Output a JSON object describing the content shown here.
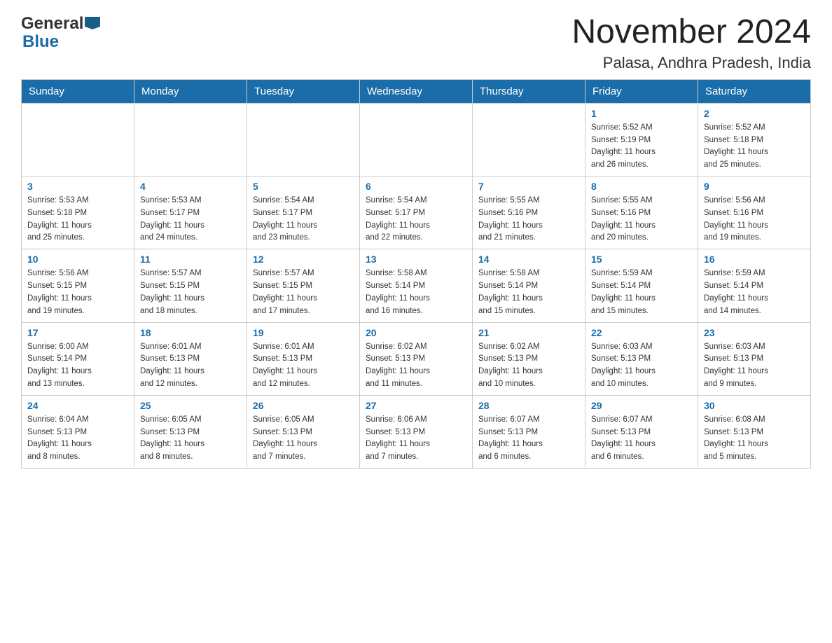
{
  "logo": {
    "general": "General",
    "blue": "Blue"
  },
  "title": "November 2024",
  "subtitle": "Palasa, Andhra Pradesh, India",
  "weekdays": [
    "Sunday",
    "Monday",
    "Tuesday",
    "Wednesday",
    "Thursday",
    "Friday",
    "Saturday"
  ],
  "weeks": [
    [
      {
        "day": "",
        "info": ""
      },
      {
        "day": "",
        "info": ""
      },
      {
        "day": "",
        "info": ""
      },
      {
        "day": "",
        "info": ""
      },
      {
        "day": "",
        "info": ""
      },
      {
        "day": "1",
        "info": "Sunrise: 5:52 AM\nSunset: 5:19 PM\nDaylight: 11 hours\nand 26 minutes."
      },
      {
        "day": "2",
        "info": "Sunrise: 5:52 AM\nSunset: 5:18 PM\nDaylight: 11 hours\nand 25 minutes."
      }
    ],
    [
      {
        "day": "3",
        "info": "Sunrise: 5:53 AM\nSunset: 5:18 PM\nDaylight: 11 hours\nand 25 minutes."
      },
      {
        "day": "4",
        "info": "Sunrise: 5:53 AM\nSunset: 5:17 PM\nDaylight: 11 hours\nand 24 minutes."
      },
      {
        "day": "5",
        "info": "Sunrise: 5:54 AM\nSunset: 5:17 PM\nDaylight: 11 hours\nand 23 minutes."
      },
      {
        "day": "6",
        "info": "Sunrise: 5:54 AM\nSunset: 5:17 PM\nDaylight: 11 hours\nand 22 minutes."
      },
      {
        "day": "7",
        "info": "Sunrise: 5:55 AM\nSunset: 5:16 PM\nDaylight: 11 hours\nand 21 minutes."
      },
      {
        "day": "8",
        "info": "Sunrise: 5:55 AM\nSunset: 5:16 PM\nDaylight: 11 hours\nand 20 minutes."
      },
      {
        "day": "9",
        "info": "Sunrise: 5:56 AM\nSunset: 5:16 PM\nDaylight: 11 hours\nand 19 minutes."
      }
    ],
    [
      {
        "day": "10",
        "info": "Sunrise: 5:56 AM\nSunset: 5:15 PM\nDaylight: 11 hours\nand 19 minutes."
      },
      {
        "day": "11",
        "info": "Sunrise: 5:57 AM\nSunset: 5:15 PM\nDaylight: 11 hours\nand 18 minutes."
      },
      {
        "day": "12",
        "info": "Sunrise: 5:57 AM\nSunset: 5:15 PM\nDaylight: 11 hours\nand 17 minutes."
      },
      {
        "day": "13",
        "info": "Sunrise: 5:58 AM\nSunset: 5:14 PM\nDaylight: 11 hours\nand 16 minutes."
      },
      {
        "day": "14",
        "info": "Sunrise: 5:58 AM\nSunset: 5:14 PM\nDaylight: 11 hours\nand 15 minutes."
      },
      {
        "day": "15",
        "info": "Sunrise: 5:59 AM\nSunset: 5:14 PM\nDaylight: 11 hours\nand 15 minutes."
      },
      {
        "day": "16",
        "info": "Sunrise: 5:59 AM\nSunset: 5:14 PM\nDaylight: 11 hours\nand 14 minutes."
      }
    ],
    [
      {
        "day": "17",
        "info": "Sunrise: 6:00 AM\nSunset: 5:14 PM\nDaylight: 11 hours\nand 13 minutes."
      },
      {
        "day": "18",
        "info": "Sunrise: 6:01 AM\nSunset: 5:13 PM\nDaylight: 11 hours\nand 12 minutes."
      },
      {
        "day": "19",
        "info": "Sunrise: 6:01 AM\nSunset: 5:13 PM\nDaylight: 11 hours\nand 12 minutes."
      },
      {
        "day": "20",
        "info": "Sunrise: 6:02 AM\nSunset: 5:13 PM\nDaylight: 11 hours\nand 11 minutes."
      },
      {
        "day": "21",
        "info": "Sunrise: 6:02 AM\nSunset: 5:13 PM\nDaylight: 11 hours\nand 10 minutes."
      },
      {
        "day": "22",
        "info": "Sunrise: 6:03 AM\nSunset: 5:13 PM\nDaylight: 11 hours\nand 10 minutes."
      },
      {
        "day": "23",
        "info": "Sunrise: 6:03 AM\nSunset: 5:13 PM\nDaylight: 11 hours\nand 9 minutes."
      }
    ],
    [
      {
        "day": "24",
        "info": "Sunrise: 6:04 AM\nSunset: 5:13 PM\nDaylight: 11 hours\nand 8 minutes."
      },
      {
        "day": "25",
        "info": "Sunrise: 6:05 AM\nSunset: 5:13 PM\nDaylight: 11 hours\nand 8 minutes."
      },
      {
        "day": "26",
        "info": "Sunrise: 6:05 AM\nSunset: 5:13 PM\nDaylight: 11 hours\nand 7 minutes."
      },
      {
        "day": "27",
        "info": "Sunrise: 6:06 AM\nSunset: 5:13 PM\nDaylight: 11 hours\nand 7 minutes."
      },
      {
        "day": "28",
        "info": "Sunrise: 6:07 AM\nSunset: 5:13 PM\nDaylight: 11 hours\nand 6 minutes."
      },
      {
        "day": "29",
        "info": "Sunrise: 6:07 AM\nSunset: 5:13 PM\nDaylight: 11 hours\nand 6 minutes."
      },
      {
        "day": "30",
        "info": "Sunrise: 6:08 AM\nSunset: 5:13 PM\nDaylight: 11 hours\nand 5 minutes."
      }
    ]
  ]
}
